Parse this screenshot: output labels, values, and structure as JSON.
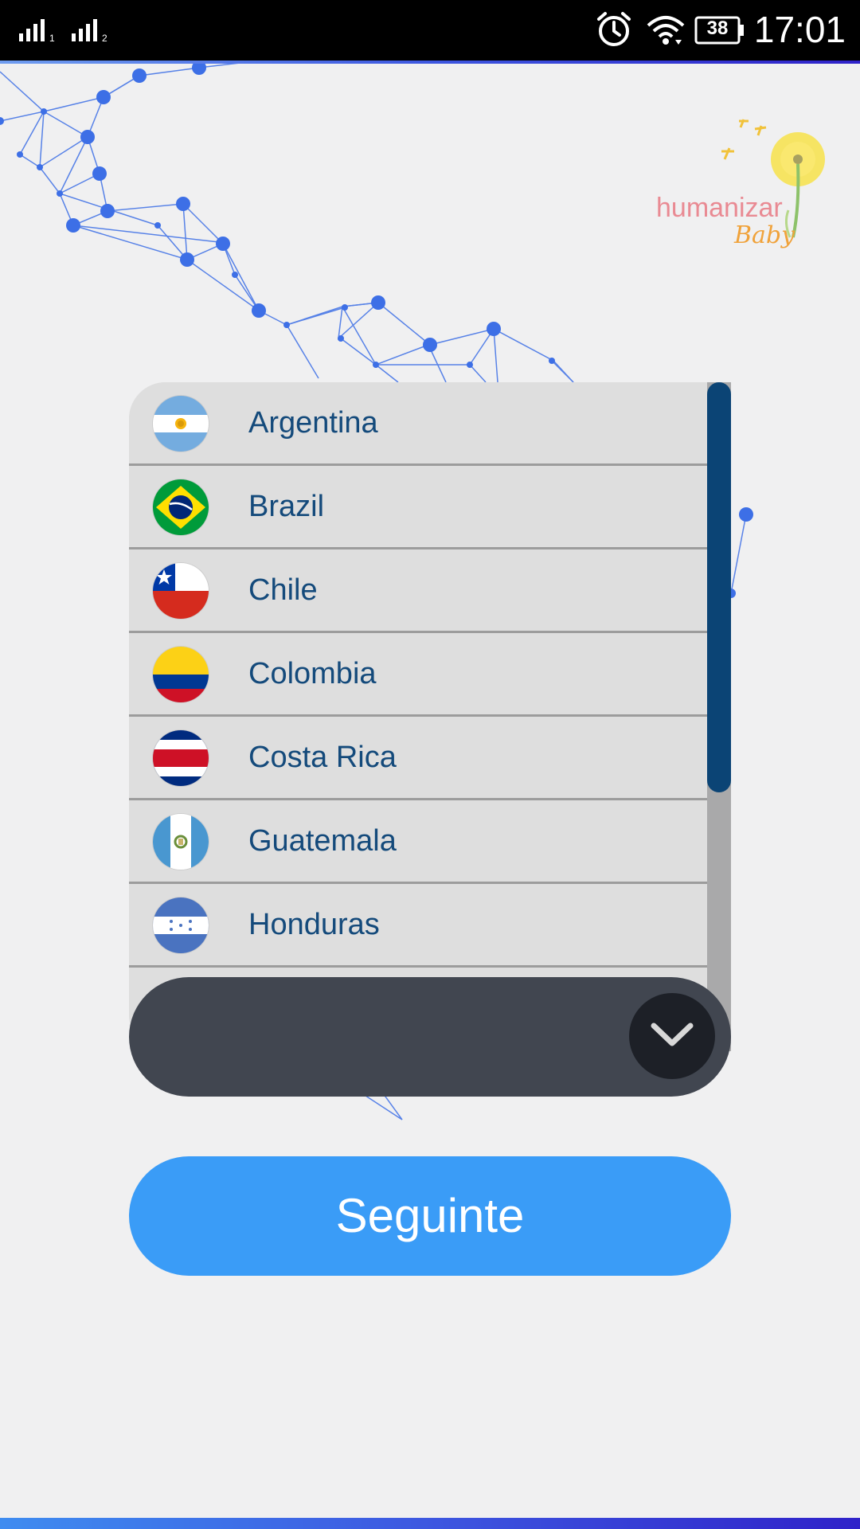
{
  "status_bar": {
    "signal_1_label": "1",
    "signal_2_label": "2",
    "battery_level": "38",
    "time": "17:01",
    "icons": [
      "signal-icon",
      "signal-icon",
      "alarm-icon",
      "wifi-icon",
      "battery-icon"
    ]
  },
  "logo": {
    "brand": "humanizar",
    "sub": "Baby"
  },
  "country_list": {
    "items": [
      {
        "name": "Argentina",
        "flag": "argentina-flag-icon"
      },
      {
        "name": "Brazil",
        "flag": "brazil-flag-icon"
      },
      {
        "name": "Chile",
        "flag": "chile-flag-icon"
      },
      {
        "name": "Colombia",
        "flag": "colombia-flag-icon"
      },
      {
        "name": "Costa Rica",
        "flag": "costa-rica-flag-icon"
      },
      {
        "name": "Guatemala",
        "flag": "guatemala-flag-icon"
      },
      {
        "name": "Honduras",
        "flag": "honduras-flag-icon"
      }
    ],
    "dropdown_icon": "chevron-down-icon"
  },
  "next_button": {
    "label": "Seguinte"
  },
  "colors": {
    "accent": "#3a9cf7",
    "text": "#144a7b",
    "scroll_thumb": "#0b4475",
    "dropdown_bar": "#414650",
    "network": "#3d6fe6"
  }
}
